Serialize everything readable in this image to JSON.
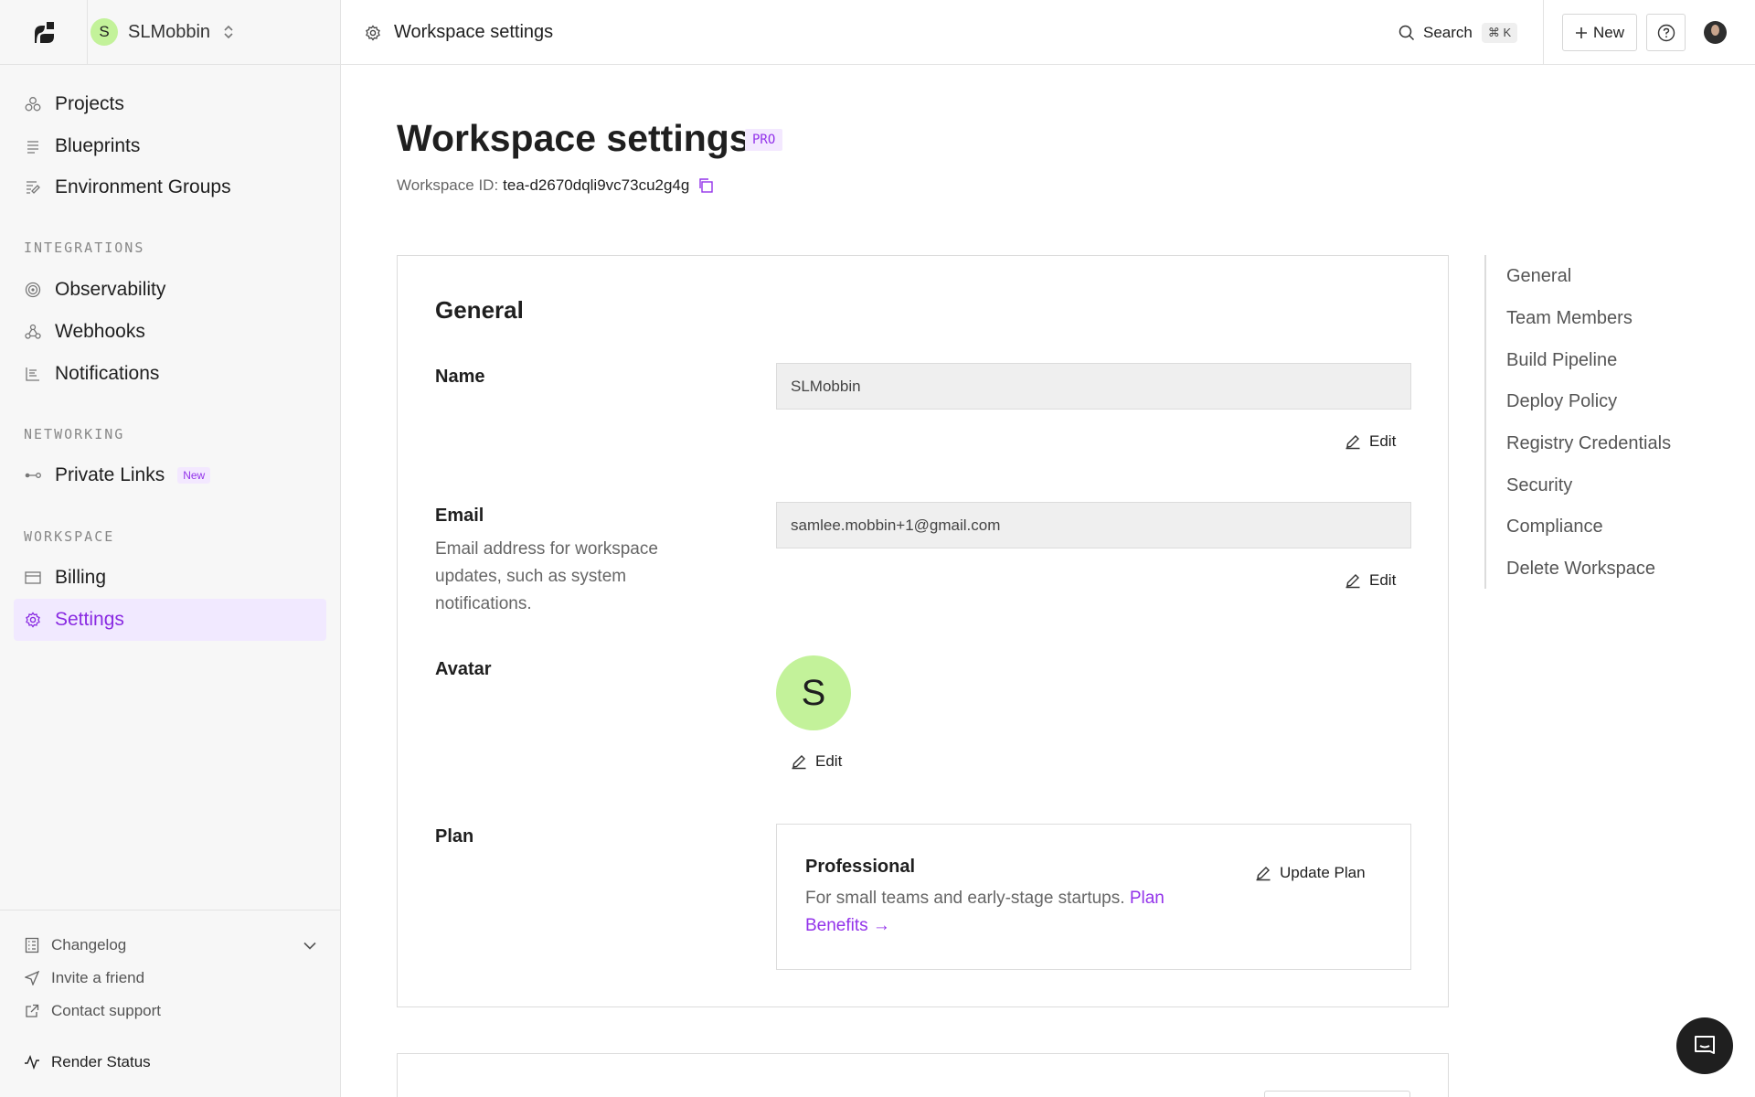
{
  "workspace": {
    "avatar_letter": "S",
    "name": "SLMobbin"
  },
  "sidebar": {
    "items": [
      {
        "label": "Projects",
        "icon": "projects-icon"
      },
      {
        "label": "Blueprints",
        "icon": "blueprints-icon"
      },
      {
        "label": "Environment Groups",
        "icon": "environment-groups-icon"
      }
    ],
    "sections": {
      "integrations": {
        "label": "INTEGRATIONS",
        "items": [
          {
            "label": "Observability",
            "icon": "observability-icon"
          },
          {
            "label": "Webhooks",
            "icon": "webhooks-icon"
          },
          {
            "label": "Notifications",
            "icon": "notifications-icon"
          }
        ]
      },
      "networking": {
        "label": "NETWORKING",
        "items": [
          {
            "label": "Private Links",
            "icon": "private-links-icon",
            "badge": "New"
          }
        ]
      },
      "workspace": {
        "label": "WORKSPACE",
        "items": [
          {
            "label": "Billing",
            "icon": "billing-icon"
          },
          {
            "label": "Settings",
            "icon": "settings-icon",
            "active": true
          }
        ]
      }
    },
    "footer": {
      "changelog": "Changelog",
      "invite": "Invite a friend",
      "support": "Contact support",
      "status": "Render Status"
    }
  },
  "topbar": {
    "breadcrumb": "Workspace settings",
    "search_label": "Search",
    "search_shortcut": "⌘ K",
    "new_label": "New"
  },
  "main": {
    "title": "Workspace settings",
    "plan_badge": "PRO",
    "workspace_id_label": "Workspace ID:",
    "workspace_id": "tea-d2670dqli9vc73cu2g4g",
    "general": {
      "heading": "General",
      "name_label": "Name",
      "name_value": "SLMobbin",
      "email_label": "Email",
      "email_desc": "Email address for workspace updates, such as system notifications.",
      "email_value": "samlee.mobbin+1@gmail.com",
      "avatar_label": "Avatar",
      "avatar_letter": "S",
      "edit_label": "Edit",
      "plan_label": "Plan",
      "plan_name": "Professional",
      "plan_desc": "For small teams and early-stage startups.",
      "plan_link": "Plan Benefits →",
      "update_plan_label": "Update Plan"
    }
  },
  "toc": [
    "General",
    "Team Members",
    "Build Pipeline",
    "Deploy Policy",
    "Registry Credentials",
    "Security",
    "Compliance",
    "Delete Workspace"
  ],
  "colors": {
    "accent": "#9333ea",
    "avatar_bg": "#c3f29a",
    "active_bg": "#f1e9ff"
  }
}
